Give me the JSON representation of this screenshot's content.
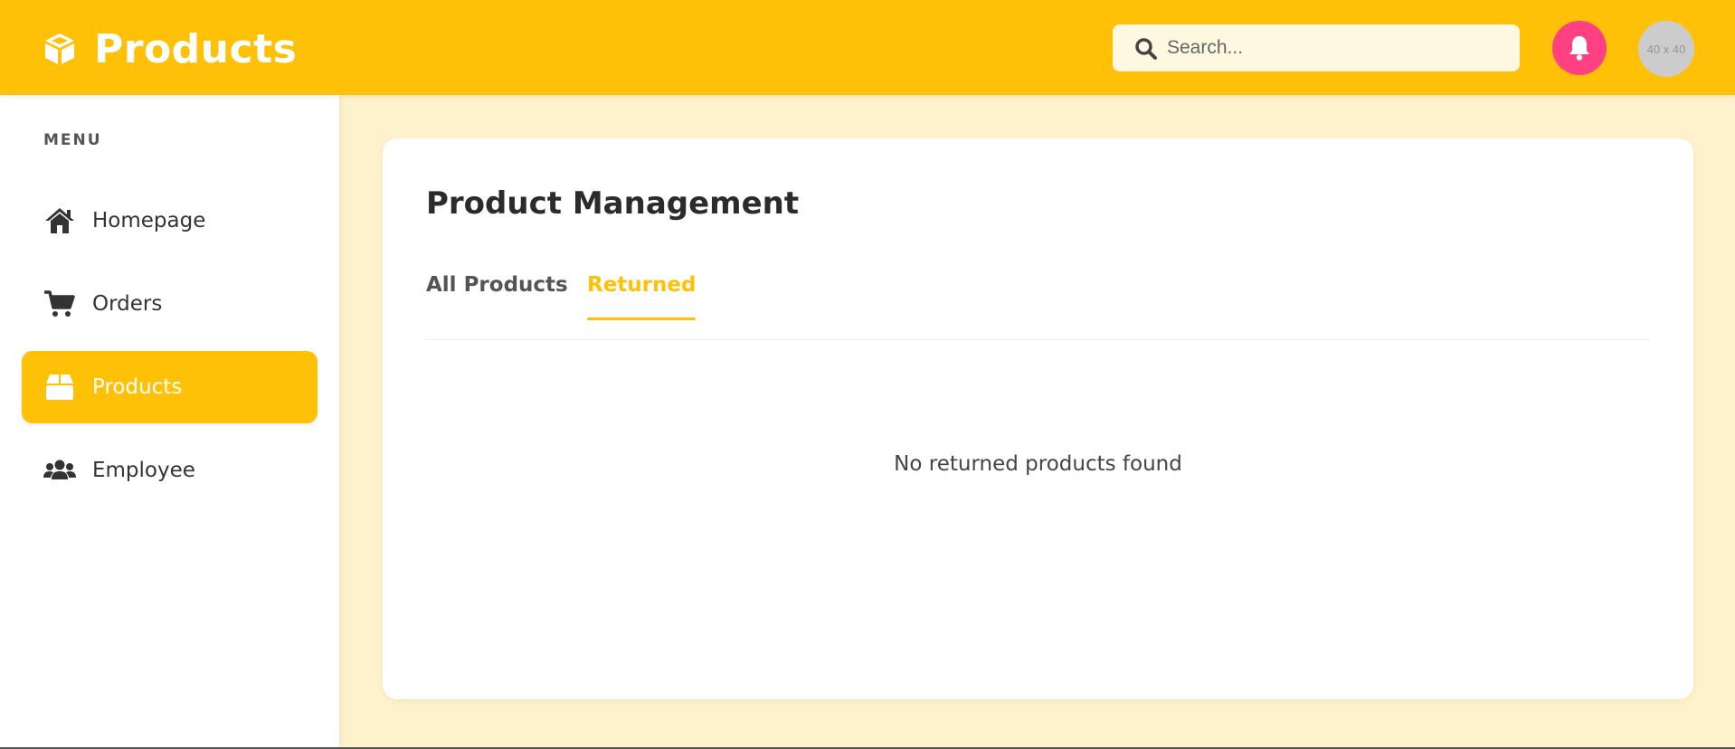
{
  "header": {
    "title": "Products",
    "brand_icon": "cube-icon",
    "search": {
      "placeholder": "Search...",
      "value": ""
    },
    "notification_icon": "bell-icon",
    "avatar_placeholder": "40 x 40"
  },
  "sidebar": {
    "heading": "MENU",
    "items": [
      {
        "label": "Homepage",
        "icon": "home-icon",
        "active": false
      },
      {
        "label": "Orders",
        "icon": "cart-icon",
        "active": false
      },
      {
        "label": "Products",
        "icon": "box-icon",
        "active": true
      },
      {
        "label": "Employee",
        "icon": "users-icon",
        "active": false
      }
    ]
  },
  "main": {
    "title": "Product Management",
    "tabs": [
      {
        "label": "All Products",
        "active": false
      },
      {
        "label": "Returned",
        "active": true
      }
    ],
    "empty_message": "No returned products found"
  },
  "colors": {
    "accent": "#ffc107",
    "background": "#fef2cc",
    "notification": "#ff4081",
    "avatar": "#cccccc"
  }
}
